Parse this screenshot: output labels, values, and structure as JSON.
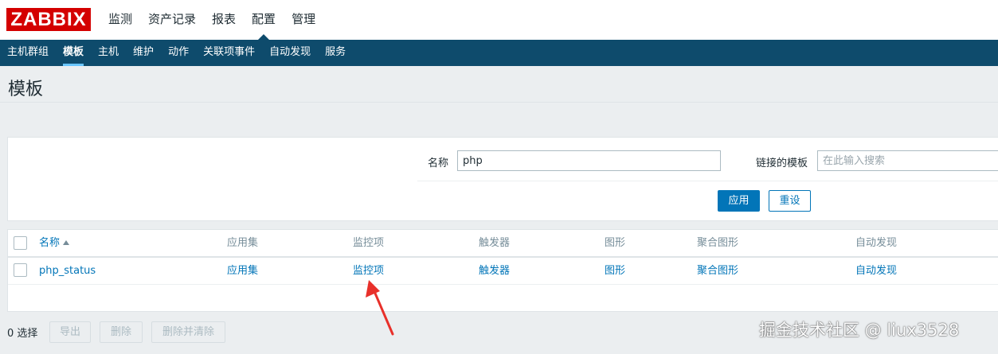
{
  "logo": {
    "text": "ZABBIX"
  },
  "main_menu": [
    {
      "label": "监测"
    },
    {
      "label": "资产记录"
    },
    {
      "label": "报表"
    },
    {
      "label": "配置",
      "active": true
    },
    {
      "label": "管理"
    }
  ],
  "sub_menu": [
    {
      "label": "主机群组"
    },
    {
      "label": "模板",
      "active": true
    },
    {
      "label": "主机"
    },
    {
      "label": "维护"
    },
    {
      "label": "动作"
    },
    {
      "label": "关联项事件"
    },
    {
      "label": "自动发现"
    },
    {
      "label": "服务"
    }
  ],
  "page": {
    "title": "模板"
  },
  "filter": {
    "name_label": "名称",
    "name_value": "php",
    "linked_label": "链接的模板",
    "linked_placeholder": "在此输入搜索",
    "apply_label": "应用",
    "reset_label": "重设"
  },
  "table": {
    "columns": [
      "名称",
      "应用集",
      "监控项",
      "触发器",
      "图形",
      "聚合图形",
      "自动发现"
    ],
    "rows": [
      {
        "name": "php_status",
        "applications": "应用集",
        "items": "监控项",
        "triggers": "触发器",
        "graphs": "图形",
        "screens": "聚合图形",
        "discovery": "自动发现"
      }
    ]
  },
  "footer": {
    "selected": "0 选择",
    "export_label": "导出",
    "delete_label": "删除",
    "delete_clear_label": "删除并清除"
  },
  "annotation_color": "#e8302a",
  "watermark": "掘金技术社区 @ liux3528"
}
